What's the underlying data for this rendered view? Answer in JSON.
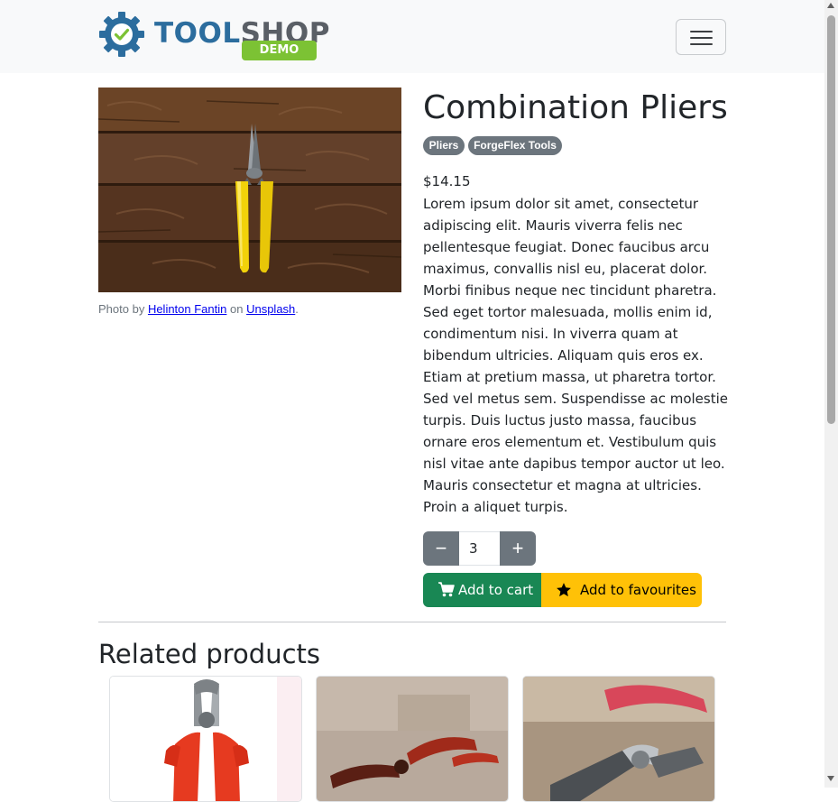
{
  "brand": {
    "name_part1": "TOOL",
    "name_part2": "SHOP",
    "tag": "DEMO"
  },
  "nav": {
    "toggler_label": "Toggle navigation"
  },
  "product": {
    "name": "Combination Pliers",
    "badges": [
      "Pliers",
      "ForgeFlex Tools"
    ],
    "price": "$14.15",
    "description": "Lorem ipsum dolor sit amet, consectetur adipiscing elit. Mauris viverra felis nec pellentesque feugiat. Donec faucibus arcu maximus, convallis nisl eu, placerat dolor. Morbi finibus neque nec tincidunt pharetra. Sed eget tortor malesuada, mollis enim id, condimentum nisi. In viverra quam at bibendum ultricies. Aliquam quis eros ex. Etiam at pretium massa, ut pharetra tortor. Sed vel metus sem. Suspendisse ac molestie turpis. Duis luctus justo massa, faucibus ornare eros elementum et. Vestibulum quis nisl vitae ante dapibus tempor auctor ut leo. Mauris consectetur et magna at ultricies. Proin a aliquet turpis.",
    "quantity": "3",
    "image_caption": {
      "prefix": "Photo by ",
      "author": "Helinton Fantin",
      "middle": " on ",
      "source": "Unsplash",
      "suffix": "."
    }
  },
  "actions": {
    "minus": "−",
    "plus": "+",
    "add_to_cart": "Add to cart",
    "add_to_favourites": "Add to favourites"
  },
  "related": {
    "title": "Related products"
  },
  "colors": {
    "primary_dark": "#2c6d9e",
    "accent_green": "#7cc234",
    "cart_green": "#198754",
    "fav_yellow": "#ffc107",
    "secondary": "#6c757d"
  },
  "icons": {
    "logo": "gear-check-icon",
    "menu": "hamburger-icon",
    "cart": "cart-icon",
    "favourite": "star-icon"
  }
}
